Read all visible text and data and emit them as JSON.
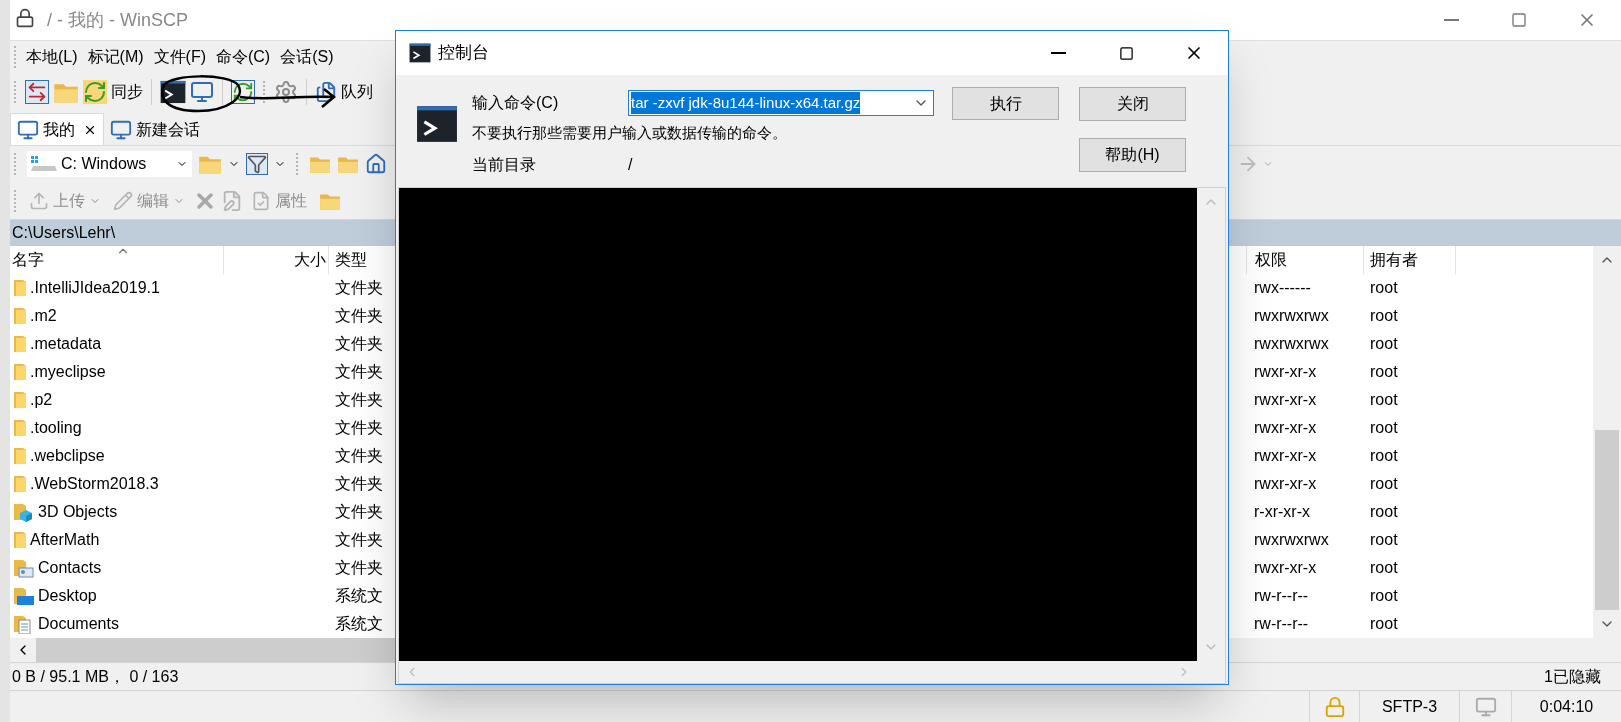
{
  "window": {
    "title": "/ - 我的 - WinSCP"
  },
  "menu": [
    "本地(L)",
    "标记(M)",
    "文件(F)",
    "命令(C)",
    "会话(S)"
  ],
  "toolbar": {
    "sync_label": "同步",
    "queue_label": "队列"
  },
  "tabs": [
    {
      "label": "我的",
      "selected": true
    },
    {
      "label": "新建会话",
      "selected": false
    }
  ],
  "drive": {
    "value": "C: Windows"
  },
  "actions": [
    {
      "kind": "dropdown",
      "label": "上传"
    },
    {
      "kind": "dropdown",
      "label": "编辑"
    },
    {
      "kind": "delete"
    },
    {
      "kind": "rename"
    },
    {
      "kind": "labeled",
      "label": "属性"
    },
    {
      "kind": "newfolder"
    }
  ],
  "local_path": "C:\\Users\\Lehr\\",
  "left_columns": [
    "名字",
    "大小",
    "类型"
  ],
  "right_columns": [
    "权限",
    "拥有者"
  ],
  "files": [
    {
      "name": ".IntelliJIdea2019.1",
      "kind": "folder",
      "type": "文件夹",
      "permissions": "rwx------",
      "owner": "root"
    },
    {
      "name": ".m2",
      "kind": "folder",
      "type": "文件夹",
      "permissions": "rwxrwxrwx",
      "owner": "root"
    },
    {
      "name": ".metadata",
      "kind": "folder",
      "type": "文件夹",
      "permissions": "rwxrwxrwx",
      "owner": "root"
    },
    {
      "name": ".myeclipse",
      "kind": "folder",
      "type": "文件夹",
      "permissions": "rwxr-xr-x",
      "owner": "root"
    },
    {
      "name": ".p2",
      "kind": "folder",
      "type": "文件夹",
      "permissions": "rwxr-xr-x",
      "owner": "root"
    },
    {
      "name": ".tooling",
      "kind": "folder",
      "type": "文件夹",
      "permissions": "rwxr-xr-x",
      "owner": "root"
    },
    {
      "name": ".webclipse",
      "kind": "folder",
      "type": "文件夹",
      "permissions": "rwxr-xr-x",
      "owner": "root"
    },
    {
      "name": ".WebStorm2018.3",
      "kind": "folder",
      "type": "文件夹",
      "permissions": "rwxr-xr-x",
      "owner": "root"
    },
    {
      "name": "3D Objects",
      "kind": "objects3d",
      "type": "文件夹",
      "permissions": "r-xr-xr-x",
      "owner": "root"
    },
    {
      "name": "AfterMath",
      "kind": "folder",
      "type": "文件夹",
      "permissions": "rwxrwxrwx",
      "owner": "root"
    },
    {
      "name": "Contacts",
      "kind": "contacts",
      "type": "文件夹",
      "permissions": "rwxr-xr-x",
      "owner": "root"
    },
    {
      "name": "Desktop",
      "kind": "desktop",
      "type": "系统文",
      "permissions": "rw-r--r--",
      "owner": "root"
    },
    {
      "name": "Documents",
      "kind": "documents",
      "type": "系统文",
      "permissions": "rw-r--r--",
      "owner": "root"
    }
  ],
  "status": {
    "selection": "0 B / 95.1 MB， 0 / 163",
    "hidden": "1已隐藏"
  },
  "bottom": {
    "protocol": "SFTP-3",
    "elapsed": "0:04:10"
  },
  "dialog": {
    "title": "控制台",
    "command_label": "输入命令(C)",
    "command": "tar -zxvf jdk-8u144-linux-x64.tar.gz",
    "warning": "不要执行那些需要用户输入或数据传输的命令。",
    "dir_label": "当前目录",
    "dir": "/",
    "buttons": [
      "执行",
      "关闭",
      "帮助(H)"
    ]
  }
}
